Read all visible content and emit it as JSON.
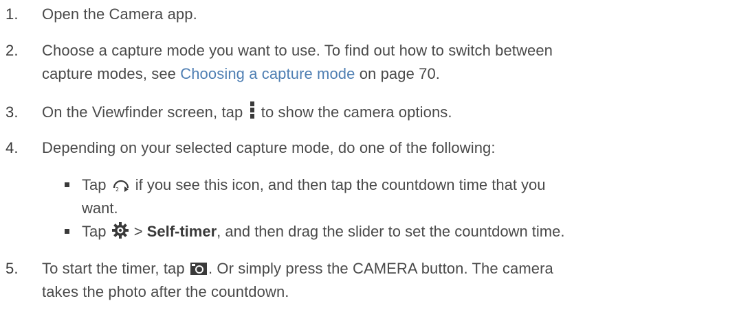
{
  "steps": [
    {
      "number": "1.",
      "text": "Open the Camera app."
    },
    {
      "number": "2.",
      "text_before": "Choose a capture mode you want to use. To find out how to switch between",
      "text_line2_before": "capture modes, see ",
      "link": "Choosing a capture mode",
      "text_after": " on page 70."
    },
    {
      "number": "3.",
      "text_before": "On the Viewfinder screen, tap ",
      "icon": "more-options-icon",
      "text_after": " to show the camera options."
    },
    {
      "number": "4.",
      "text": "Depending on your selected capture mode, do one of the following:",
      "bullets": [
        {
          "text_before": "Tap ",
          "icon": "timer-icon",
          "text_after": " if you see this icon, and then tap the countdown time that you",
          "text_line2": "want."
        },
        {
          "text_before": "Tap ",
          "icon": "settings-gear-icon",
          "text_mid": " > ",
          "bold": "Self-timer",
          "text_after": ", and then drag the slider to set the countdown time."
        }
      ]
    },
    {
      "number": "5.",
      "text_before": "To start the timer, tap ",
      "icon": "camera-shutter-icon",
      "text_after": ". Or simply press the CAMERA button. The camera",
      "text_line2": "takes the photo after the countdown."
    }
  ],
  "colors": {
    "text": "#4a4a4a",
    "link": "#4f7fb3",
    "icon": "#3a3a3a"
  }
}
